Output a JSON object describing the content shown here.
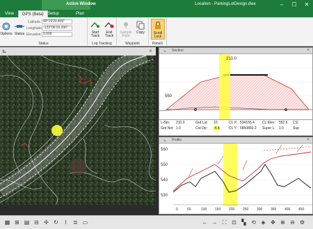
{
  "titlebar": {
    "active_window": "Active Window",
    "title": "Location - ParkingLotDesign.dwx"
  },
  "tabs": [
    {
      "label": "View"
    },
    {
      "label": "GPS (Beta)"
    },
    {
      "label": "Setup"
    },
    {
      "label": "Plan"
    }
  ],
  "ribbon": {
    "options_label": "Options",
    "status_button_label": "Status",
    "fields": [
      {
        "label": "Latitude",
        "value": "49°19'20.400\""
      },
      {
        "label": "Longitude",
        "value": "-123°06'10.200\""
      },
      {
        "label": "Elevation",
        "value": "0.000"
      }
    ],
    "status_group": "Status",
    "start_track": [
      "Start",
      "Track"
    ],
    "end_track": [
      "End",
      "Track"
    ],
    "log_tracking_group": "Log Tracking",
    "sample_point": [
      "Sample",
      "Point"
    ],
    "copy_label": "Copy",
    "waypoint_group": "Waypoint",
    "scroll_lock": [
      "Scroll",
      "Lock"
    ],
    "panel_group": "Panel1"
  },
  "section": {
    "title": "Section",
    "station_label": "210.0",
    "y_tick": "550",
    "info": {
      "l_stn": "L-Stn:",
      "l_stn_val": "210.0",
      "grd_lst": "Grd Lst:",
      "grd_lst_val": "10",
      "cl_x": "CL X:",
      "cl_x_val": "534155.4",
      "cl_elev": "CL Elev:",
      "cl_elev_val": "552.6",
      "cs": "CS:",
      "sup": "Sup",
      "grd_nxt": "Grd Nxt:",
      "grd_nxt_val": "1.0",
      "cut_dp": "Cut Dp:",
      "cut_dp_val": "-4.4",
      "cl_y": "CL Y:",
      "cl_y_val": "5850860.2",
      "super_l": "Super L:",
      "super_l_val": "1.0"
    }
  },
  "profile": {
    "title": "Profile",
    "y_ticks": [
      "560",
      "550",
      "540",
      "530"
    ],
    "x_ticks": [
      "0",
      "50",
      "100",
      "150",
      "200",
      "250",
      "300",
      "350",
      "400",
      "450"
    ]
  },
  "colors": {
    "accent": "#1e7c3a",
    "highlight": "#ffff33",
    "cut": "#d23030"
  }
}
